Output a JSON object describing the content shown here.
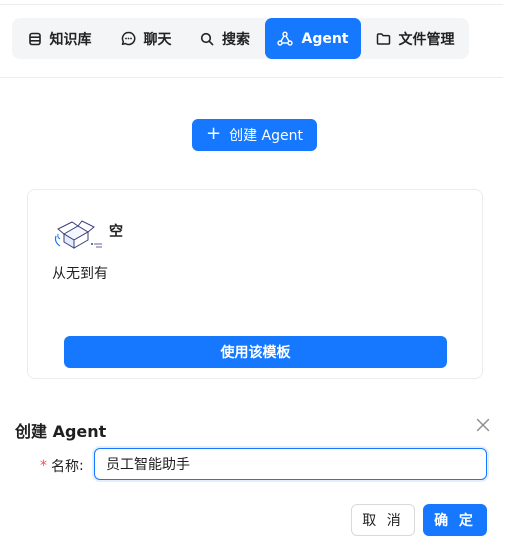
{
  "nav": {
    "tabs": [
      {
        "label": "知识库",
        "icon": "database-icon",
        "active": false
      },
      {
        "label": "聊天",
        "icon": "chat-bubble-icon",
        "active": false
      },
      {
        "label": "搜索",
        "icon": "search-icon",
        "active": false
      },
      {
        "label": "Agent",
        "icon": "network-icon",
        "active": true
      },
      {
        "label": "文件管理",
        "icon": "folder-icon",
        "active": false
      }
    ]
  },
  "toolbar": {
    "create_label": "创建 Agent"
  },
  "template_card": {
    "title": "空",
    "description": "从无到有",
    "use_label": "使用该模板"
  },
  "create_form": {
    "title": "创建 Agent",
    "name_label": "名称",
    "name_value": "员工智能助手",
    "cancel_label": "取 消",
    "ok_label": "确 定"
  },
  "colors": {
    "primary": "#1677ff",
    "nav_bg": "#f4f5f7",
    "required": "#ff4d4f"
  }
}
